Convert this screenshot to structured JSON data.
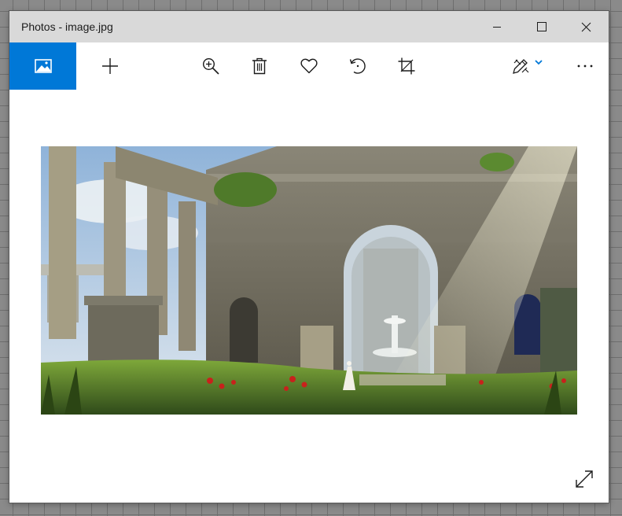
{
  "window": {
    "title": "Photos - image.jpg",
    "controls": [
      "minimize",
      "maximize",
      "close"
    ]
  },
  "toolbar": {
    "items": [
      {
        "name": "view-image",
        "icon": "image-icon",
        "active": true
      },
      {
        "name": "add",
        "icon": "plus-icon"
      },
      {
        "name": "zoom",
        "icon": "zoom-in-icon"
      },
      {
        "name": "delete",
        "icon": "trash-icon"
      },
      {
        "name": "favorite",
        "icon": "heart-icon"
      },
      {
        "name": "rotate",
        "icon": "rotate-icon"
      },
      {
        "name": "crop",
        "icon": "crop-icon"
      },
      {
        "name": "edit-create",
        "icon": "edit-create-icon",
        "has_dropdown": true
      },
      {
        "name": "more",
        "icon": "more-icon"
      }
    ]
  },
  "photo": {
    "description_icon": "photo-ruins-illustration"
  },
  "colors": {
    "accent": "#0078d7",
    "titlebar": "#d9d9d9",
    "window_bg": "#ffffff",
    "desktop": "#8a8a8a"
  }
}
